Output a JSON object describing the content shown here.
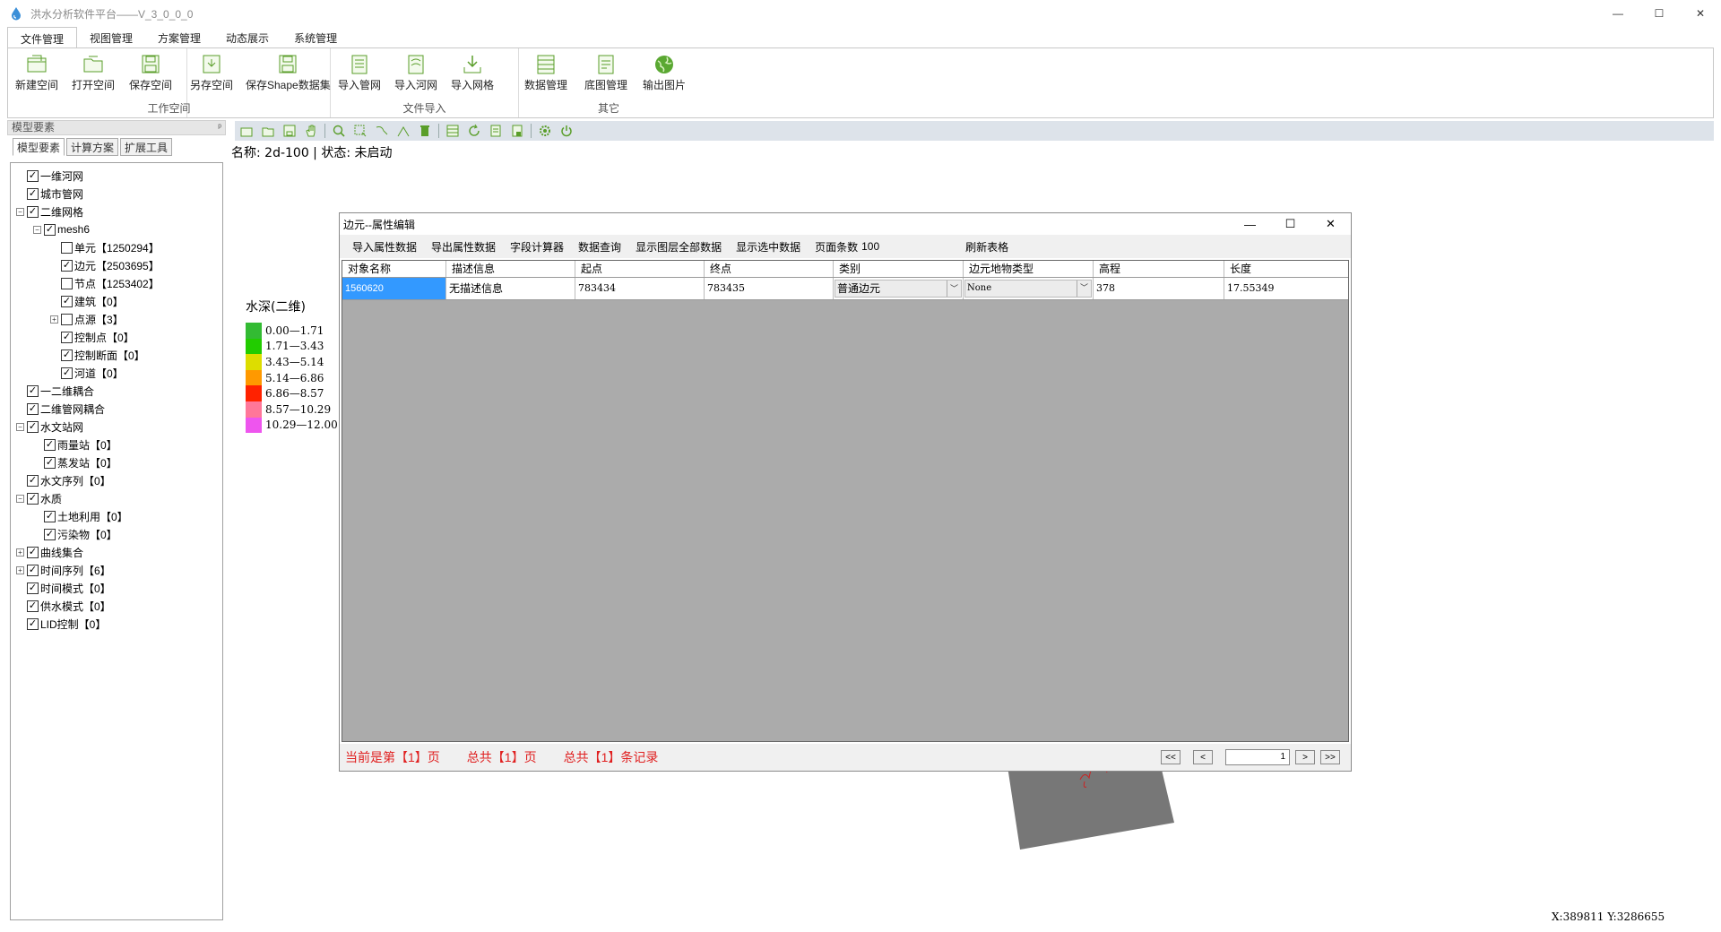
{
  "window": {
    "title": "洪水分析软件平台——V_3_0_0_0",
    "minimize": "—",
    "maximize": "☐",
    "close": "✕"
  },
  "ribbon": {
    "tabs": [
      "文件管理",
      "视图管理",
      "方案管理",
      "动态展示",
      "系统管理"
    ],
    "groups": [
      {
        "label": "工作空间",
        "buttons": [
          "新建空间",
          "打开空间",
          "保存空间",
          "另存空间",
          "保存Shape数据集"
        ]
      },
      {
        "label": "文件导入",
        "buttons": [
          "导入管网",
          "导入河网",
          "导入网格"
        ]
      },
      {
        "label": "其它",
        "buttons": [
          "数据管理",
          "底图管理",
          "输出图片"
        ]
      }
    ]
  },
  "left_panel": {
    "header": "模型要素",
    "pin": "ᵖ",
    "tabs": [
      "模型要素",
      "计算方案",
      "扩展工具"
    ],
    "tree": [
      {
        "label": "一维河网",
        "level": 0,
        "exp": "",
        "checked": true
      },
      {
        "label": "城市管网",
        "level": 0,
        "exp": "",
        "checked": true
      },
      {
        "label": "二维网格",
        "level": 0,
        "exp": "−",
        "checked": true
      },
      {
        "label": "mesh6",
        "level": 1,
        "exp": "−",
        "checked": true
      },
      {
        "label": "单元【1250294】",
        "level": 2,
        "exp": "",
        "checked": false
      },
      {
        "label": "边元【2503695】",
        "level": 2,
        "exp": "",
        "checked": true
      },
      {
        "label": "节点【1253402】",
        "level": 2,
        "exp": "",
        "checked": false
      },
      {
        "label": "建筑【0】",
        "level": 2,
        "exp": "",
        "checked": true
      },
      {
        "label": "点源【3】",
        "level": 2,
        "exp": "+",
        "checked": false
      },
      {
        "label": "控制点【0】",
        "level": 2,
        "exp": "",
        "checked": true
      },
      {
        "label": "控制断面【0】",
        "level": 2,
        "exp": "",
        "checked": true
      },
      {
        "label": "河道【0】",
        "level": 2,
        "exp": "",
        "checked": true
      },
      {
        "label": "一二维耦合",
        "level": 0,
        "exp": "",
        "checked": true
      },
      {
        "label": "二维管网耦合",
        "level": 0,
        "exp": "",
        "checked": true
      },
      {
        "label": "水文站网",
        "level": 0,
        "exp": "−",
        "checked": true
      },
      {
        "label": "雨量站【0】",
        "level": 1,
        "exp": "",
        "checked": true
      },
      {
        "label": "蒸发站【0】",
        "level": 1,
        "exp": "",
        "checked": true
      },
      {
        "label": "水文序列【0】",
        "level": 0,
        "exp": "",
        "checked": true
      },
      {
        "label": "水质",
        "level": 0,
        "exp": "−",
        "checked": true
      },
      {
        "label": "土地利用【0】",
        "level": 1,
        "exp": "",
        "checked": true
      },
      {
        "label": "污染物【0】",
        "level": 1,
        "exp": "",
        "checked": true
      },
      {
        "label": "曲线集合",
        "level": 0,
        "exp": "+",
        "checked": true
      },
      {
        "label": "时间序列【6】",
        "level": 0,
        "exp": "+",
        "checked": true
      },
      {
        "label": "时间模式【0】",
        "level": 0,
        "exp": "",
        "checked": true
      },
      {
        "label": "供水模式【0】",
        "level": 0,
        "exp": "",
        "checked": true
      },
      {
        "label": "LID控制【0】",
        "level": 0,
        "exp": "",
        "checked": true
      }
    ]
  },
  "map": {
    "status": "名称: 2d-100 | 状态: 未启动",
    "legend_title": "水深(二维)",
    "legend": [
      {
        "label": "0.00—1.71",
        "color": "#33bb33"
      },
      {
        "label": "1.71—3.43",
        "color": "#22cc00"
      },
      {
        "label": "3.43—5.14",
        "color": "#dddd00"
      },
      {
        "label": "5.14—6.86",
        "color": "#ff9900"
      },
      {
        "label": "6.86—8.57",
        "color": "#ff2200"
      },
      {
        "label": "8.57—10.29",
        "color": "#ff7799"
      },
      {
        "label": "10.29—12.00",
        "color": "#ee55ee"
      }
    ],
    "coords": "X:389811 Y:3286655"
  },
  "dialog": {
    "title": "边元--属性编辑",
    "toolbar": [
      "导入属性数据",
      "导出属性数据",
      "字段计算器",
      "数据查询",
      "显示图层全部数据",
      "显示选中数据"
    ],
    "page_size_label": "页面条数",
    "page_size_value": "100",
    "refresh": "刷新表格",
    "columns": [
      "对象名称",
      "描述信息",
      "起点",
      "终点",
      "类别",
      "边元地物类型",
      "高程",
      "长度"
    ],
    "row": [
      "1560620",
      "无描述信息",
      "783434",
      "783435",
      "普通边元",
      "None",
      "378",
      "17.55349"
    ],
    "footer": {
      "current_page": "当前是第【1】页",
      "total_pages": "总共【1】页",
      "total_records": "总共【1】条记录",
      "first": "<<",
      "prev": "<",
      "page_input": "1",
      "next": ">",
      "last": ">>"
    }
  }
}
